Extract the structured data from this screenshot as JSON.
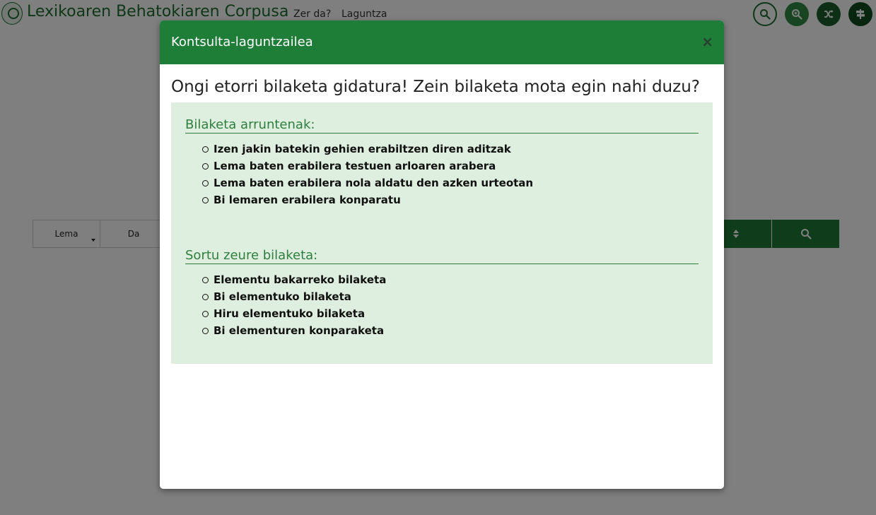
{
  "header": {
    "app_title": "Lexikoaren Behatokiaren Corpusa",
    "nav": [
      "Zer da?",
      "Laguntza"
    ],
    "icons": [
      "search-icon",
      "zoom-in-icon",
      "shuffle-icon",
      "signpost-icon"
    ]
  },
  "search_bar": {
    "lema_label": "Lema",
    "da_label": "Da"
  },
  "modal": {
    "title": "Kontsulta-laguntzailea",
    "close": "×",
    "heading": "Ongi etorri bilaketa gidatura! Zein bilaketa mota egin nahi duzu?",
    "sections": [
      {
        "title": "Bilaketa arruntenak:",
        "items": [
          "Izen jakin batekin gehien erabiltzen diren aditzak",
          "Lema baten erabilera testuen arloaren arabera",
          "Lema baten erabilera nola aldatu den azken urteotan",
          "Bi lemaren erabilera konparatu"
        ]
      },
      {
        "title": "Sortu zeure bilaketa:",
        "items": [
          "Elementu bakarreko bilaketa",
          "Bi elementuko bilaketa",
          "Hiru elementuko bilaketa",
          "Bi elementuren konparaketa"
        ]
      }
    ]
  },
  "colors": {
    "brand_green": "#1e7e38",
    "help_box_bg": "#dfefdf",
    "section_title": "#2e7f3e"
  }
}
